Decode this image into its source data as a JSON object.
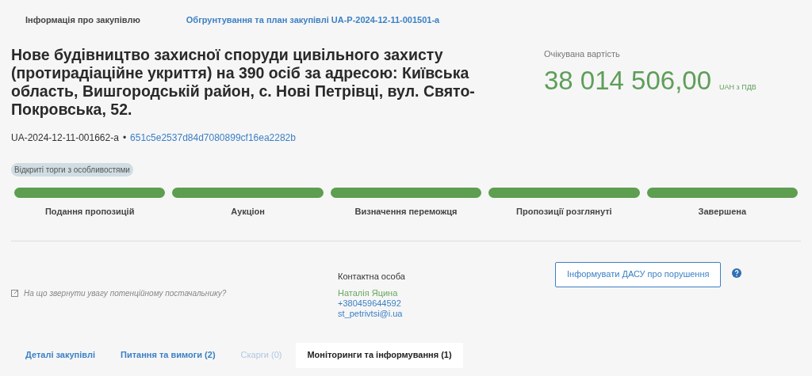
{
  "top_tabs": [
    {
      "label": "Інформація про закупівлю",
      "selected": true
    },
    {
      "label": "Обгрунтування та план закупівлі UA-P-2024-12-11-001501-a",
      "selected": false
    }
  ],
  "title": "Нове будівництво захисної споруди цивільного захисту (протирадіаційне укриття) на 390 осіб за адресою: Київська область, Вишгородській район, с. Нові Петрівці, вул. Свято-Покровська, 52.",
  "tender_id": "UA-2024-12-11-001662-a",
  "separator": "•",
  "hash": "651c5e2537d84d7080899cf16ea2282b",
  "procedure_badge": "Відкриті торги з особливостями",
  "expected_value": {
    "label": "Очікувана вартість",
    "amount": "38 014 506,00",
    "currency": "UAH з ПДВ"
  },
  "stages": [
    {
      "label": "Подання пропозицій",
      "done": true
    },
    {
      "label": "Аукціон",
      "done": true
    },
    {
      "label": "Визначення переможця",
      "done": true
    },
    {
      "label": "Пропозиції розглянуті",
      "done": true
    },
    {
      "label": "Завершена",
      "done": true
    }
  ],
  "supplier_hint": "На що звернути увагу потенційному постачальнику?",
  "contact": {
    "heading": "Контактна особа",
    "name": "Наталія Яцина",
    "phone": "+380459644592",
    "email": "st_petrivtsi@i.ua"
  },
  "report_button": "Інформувати ДАСУ про порушення",
  "bottom_tabs": [
    {
      "label": "Деталі закупівлі",
      "selected": false,
      "disabled": false
    },
    {
      "label": "Питання та вимоги (2)",
      "selected": false,
      "disabled": false
    },
    {
      "label": "Скарги (0)",
      "selected": false,
      "disabled": true
    },
    {
      "label": "Моніторинги та інформування (1)",
      "selected": true,
      "disabled": false
    }
  ]
}
